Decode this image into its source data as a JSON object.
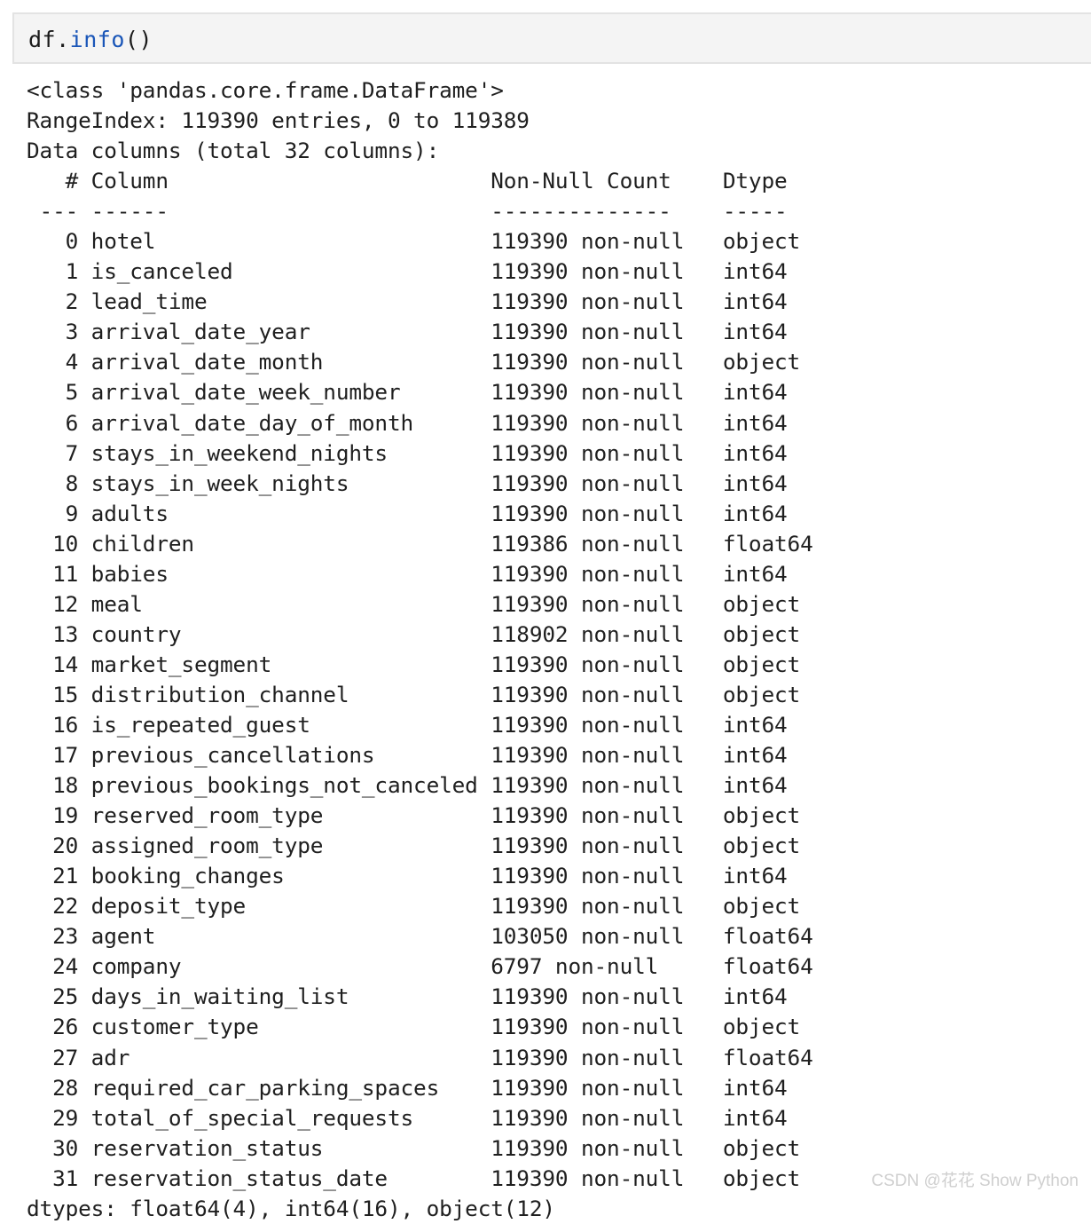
{
  "code_cell": {
    "prompt_object": "df",
    "dot": ".",
    "method": "info",
    "parens": "()",
    "full_text": "df.info()"
  },
  "output": {
    "class_line": "<class 'pandas.core.frame.DataFrame'>",
    "index_line": "RangeIndex: 119390 entries, 0 to 119389",
    "columns_line": "Data columns (total 32 columns):",
    "header": {
      "num": "#",
      "column": "Column",
      "non_null": "Non-Null Count",
      "dtype": "Dtype"
    },
    "separator": {
      "num": "---",
      "column": "------",
      "non_null": "--------------",
      "dtype": "-----"
    },
    "non_null_suffix": "non-null",
    "rows": [
      {
        "index": "0",
        "name": "hotel",
        "count": "119390",
        "dtype": "object"
      },
      {
        "index": "1",
        "name": "is_canceled",
        "count": "119390",
        "dtype": "int64"
      },
      {
        "index": "2",
        "name": "lead_time",
        "count": "119390",
        "dtype": "int64"
      },
      {
        "index": "3",
        "name": "arrival_date_year",
        "count": "119390",
        "dtype": "int64"
      },
      {
        "index": "4",
        "name": "arrival_date_month",
        "count": "119390",
        "dtype": "object"
      },
      {
        "index": "5",
        "name": "arrival_date_week_number",
        "count": "119390",
        "dtype": "int64"
      },
      {
        "index": "6",
        "name": "arrival_date_day_of_month",
        "count": "119390",
        "dtype": "int64"
      },
      {
        "index": "7",
        "name": "stays_in_weekend_nights",
        "count": "119390",
        "dtype": "int64"
      },
      {
        "index": "8",
        "name": "stays_in_week_nights",
        "count": "119390",
        "dtype": "int64"
      },
      {
        "index": "9",
        "name": "adults",
        "count": "119390",
        "dtype": "int64"
      },
      {
        "index": "10",
        "name": "children",
        "count": "119386",
        "dtype": "float64"
      },
      {
        "index": "11",
        "name": "babies",
        "count": "119390",
        "dtype": "int64"
      },
      {
        "index": "12",
        "name": "meal",
        "count": "119390",
        "dtype": "object"
      },
      {
        "index": "13",
        "name": "country",
        "count": "118902",
        "dtype": "object"
      },
      {
        "index": "14",
        "name": "market_segment",
        "count": "119390",
        "dtype": "object"
      },
      {
        "index": "15",
        "name": "distribution_channel",
        "count": "119390",
        "dtype": "object"
      },
      {
        "index": "16",
        "name": "is_repeated_guest",
        "count": "119390",
        "dtype": "int64"
      },
      {
        "index": "17",
        "name": "previous_cancellations",
        "count": "119390",
        "dtype": "int64"
      },
      {
        "index": "18",
        "name": "previous_bookings_not_canceled",
        "count": "119390",
        "dtype": "int64"
      },
      {
        "index": "19",
        "name": "reserved_room_type",
        "count": "119390",
        "dtype": "object"
      },
      {
        "index": "20",
        "name": "assigned_room_type",
        "count": "119390",
        "dtype": "object"
      },
      {
        "index": "21",
        "name": "booking_changes",
        "count": "119390",
        "dtype": "int64"
      },
      {
        "index": "22",
        "name": "deposit_type",
        "count": "119390",
        "dtype": "object"
      },
      {
        "index": "23",
        "name": "agent",
        "count": "103050",
        "dtype": "float64"
      },
      {
        "index": "24",
        "name": "company",
        "count": "6797",
        "dtype": "float64"
      },
      {
        "index": "25",
        "name": "days_in_waiting_list",
        "count": "119390",
        "dtype": "int64"
      },
      {
        "index": "26",
        "name": "customer_type",
        "count": "119390",
        "dtype": "object"
      },
      {
        "index": "27",
        "name": "adr",
        "count": "119390",
        "dtype": "float64"
      },
      {
        "index": "28",
        "name": "required_car_parking_spaces",
        "count": "119390",
        "dtype": "int64"
      },
      {
        "index": "29",
        "name": "total_of_special_requests",
        "count": "119390",
        "dtype": "int64"
      },
      {
        "index": "30",
        "name": "reservation_status",
        "count": "119390",
        "dtype": "object"
      },
      {
        "index": "31",
        "name": "reservation_status_date",
        "count": "119390",
        "dtype": "object"
      }
    ],
    "dtypes_line": "dtypes: float64(4), int64(16), object(12)"
  },
  "watermark": {
    "text": "CSDN @花花 Show Python"
  },
  "colors": {
    "page_background": "#ffffff",
    "cell_background": "#f4f4f4",
    "cell_border": "#e3e3e3",
    "text": "#1f1f1f",
    "function_token": "#1a56b8",
    "watermark": "#cfcfcf"
  }
}
